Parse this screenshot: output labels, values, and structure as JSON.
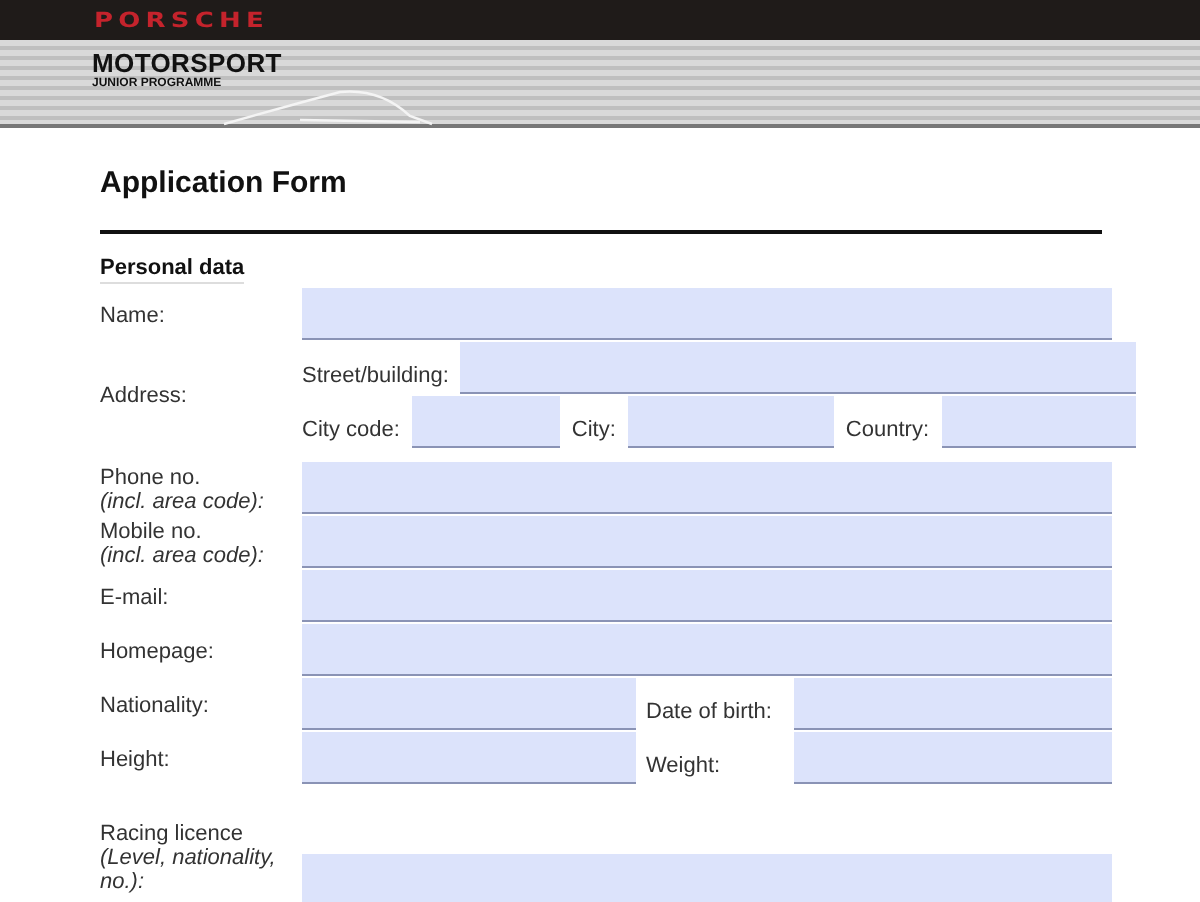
{
  "header": {
    "brand": "PORSCHE",
    "title": "MOTORSPORT",
    "subtitle": "JUNIOR PROGRAMME"
  },
  "form": {
    "title": "Application Form",
    "section": "Personal data",
    "rows": [
      {
        "kind": "single",
        "label": "Name:"
      },
      {
        "kind": "address",
        "label": "Address:",
        "street_label": "Street/building:",
        "city_code_label": "City code:",
        "city_label": "City:",
        "country_label": "Country:"
      },
      {
        "kind": "single",
        "label": "Phone no.",
        "note": "(incl. area code):"
      },
      {
        "kind": "single",
        "label": "Mobile no.",
        "note": "(incl. area code):"
      },
      {
        "kind": "single",
        "label": "E-mail:"
      },
      {
        "kind": "single",
        "label": "Homepage:"
      },
      {
        "kind": "pair",
        "label": "Nationality:",
        "second_label": "Date of birth:"
      },
      {
        "kind": "pair",
        "label": "Height:",
        "second_label": "Weight:"
      },
      {
        "kind": "tall",
        "label": "Racing licence",
        "note": "(Level, nationality, no.):"
      }
    ]
  }
}
